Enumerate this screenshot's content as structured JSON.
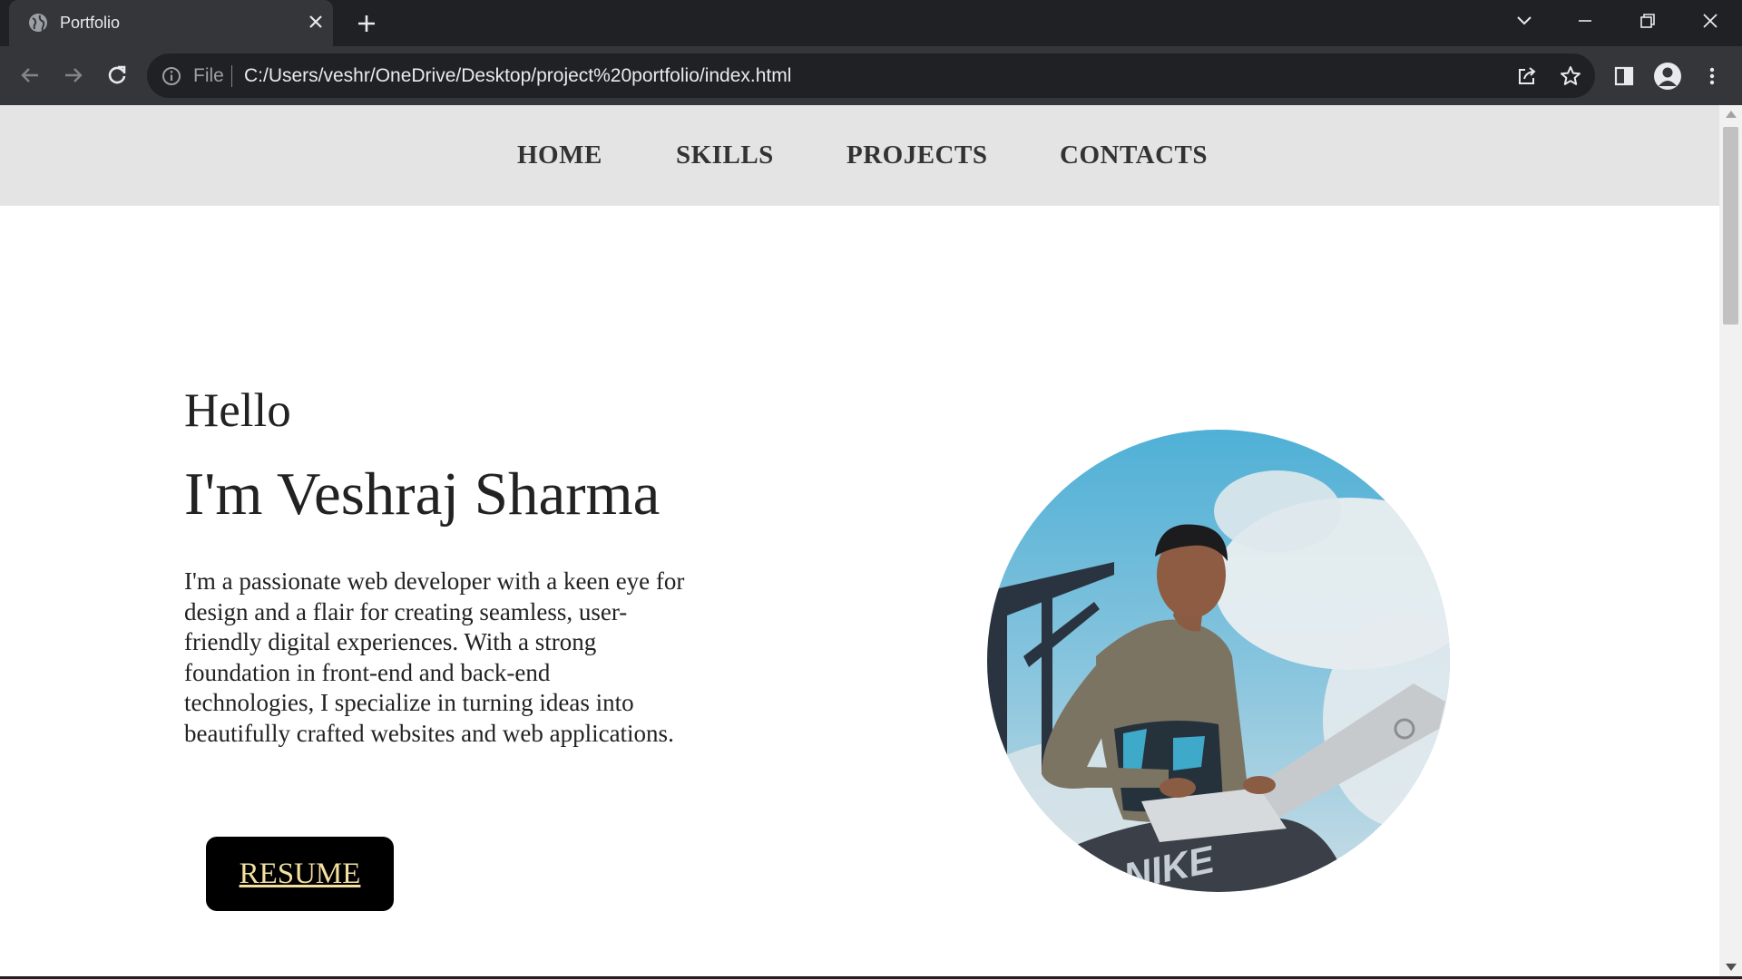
{
  "browser": {
    "tab_title": "Portfolio",
    "omnibox_scheme": "File",
    "url": "C:/Users/veshr/OneDrive/Desktop/project%20portfolio/index.html"
  },
  "page": {
    "nav": [
      "HOME",
      "SKILLS",
      "PROJECTS",
      "CONTACTS"
    ],
    "hero": {
      "greeting": "Hello",
      "name": "I'm Veshraj Sharma",
      "about_lines": [
        "I'm a passionate web developer with a keen eye for",
        "design and a flair for creating seamless, user-",
        "friendly digital experiences. With a strong",
        "foundation in front-end and back-end",
        "technologies, I specialize in turning ideas into",
        "beautifully crafted websites and web applications."
      ],
      "resume_label": "RESUME"
    },
    "portrait_photo_text": "NIKE"
  },
  "icons": {
    "favicon": "globe-icon",
    "tab_close": "close-icon",
    "new_tab": "plus-icon",
    "back": "arrow-left-icon",
    "forward": "arrow-right-icon",
    "reload": "reload-icon",
    "site_info": "info-icon",
    "share": "share-icon",
    "bookmark": "star-icon",
    "side_panel": "side-panel-icon",
    "profile": "profile-icon",
    "menu": "kebab-menu-icon"
  },
  "colors": {
    "chrome_dark": "#202124",
    "chrome_toolbar": "#35363a",
    "nav_bar": "#e4e4e4",
    "resume_bg": "#000000",
    "resume_text": "#f3dfa0"
  }
}
